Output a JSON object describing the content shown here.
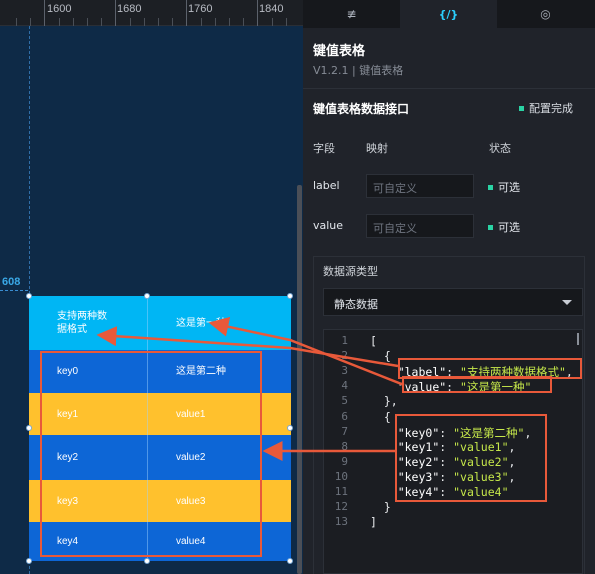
{
  "ruler": {
    "labels": [
      "1600",
      "1680",
      "1760",
      "1840"
    ]
  },
  "guide_label": "608",
  "widget": {
    "header": [
      "支持两种数\n据格式",
      "这是第一种"
    ],
    "rows": [
      [
        "key0",
        "这是第二种"
      ],
      [
        "key1",
        "value1"
      ],
      [
        "key2",
        "value2"
      ],
      [
        "key3",
        "value3"
      ],
      [
        "key4",
        "value4"
      ]
    ],
    "colors": {
      "header": "#00b6f4",
      "blue_row": "#0d66d6",
      "yellow_row": "#ffc12d"
    }
  },
  "panel": {
    "tabs": [
      {
        "icon": "sliders-icon",
        "glyph": "≢"
      },
      {
        "icon": "code-icon",
        "glyph": "{/}"
      },
      {
        "icon": "interaction-icon",
        "glyph": "◎"
      }
    ],
    "title": "键值表格",
    "subtitle": "V1.2.1 | 键值表格",
    "interface_title": "键值表格数据接口",
    "interface_status": "配置完成",
    "headers": {
      "field": "字段",
      "mapping": "映射",
      "status": "状态"
    },
    "mappings": [
      {
        "field": "label",
        "placeholder": "可自定义",
        "status": "可选"
      },
      {
        "field": "value",
        "placeholder": "可自定义",
        "status": "可选"
      }
    ],
    "datasource_label": "数据源类型",
    "datasource_value": "静态数据",
    "code_lines": [
      "[",
      "  {",
      "    \"label\": \"支持两种数据格式\",",
      "    \"value\": \"这是第一种\"",
      "  },",
      "  {",
      "    \"key0\": \"这是第二种\",",
      "    \"key1\": \"value1\",",
      "    \"key2\": \"value2\",",
      "    \"key3\": \"value3\",",
      "    \"key4\": \"value4\"",
      "  }",
      "]"
    ],
    "accent": "#2bd1ff",
    "ok_color": "#2ad3a4"
  }
}
